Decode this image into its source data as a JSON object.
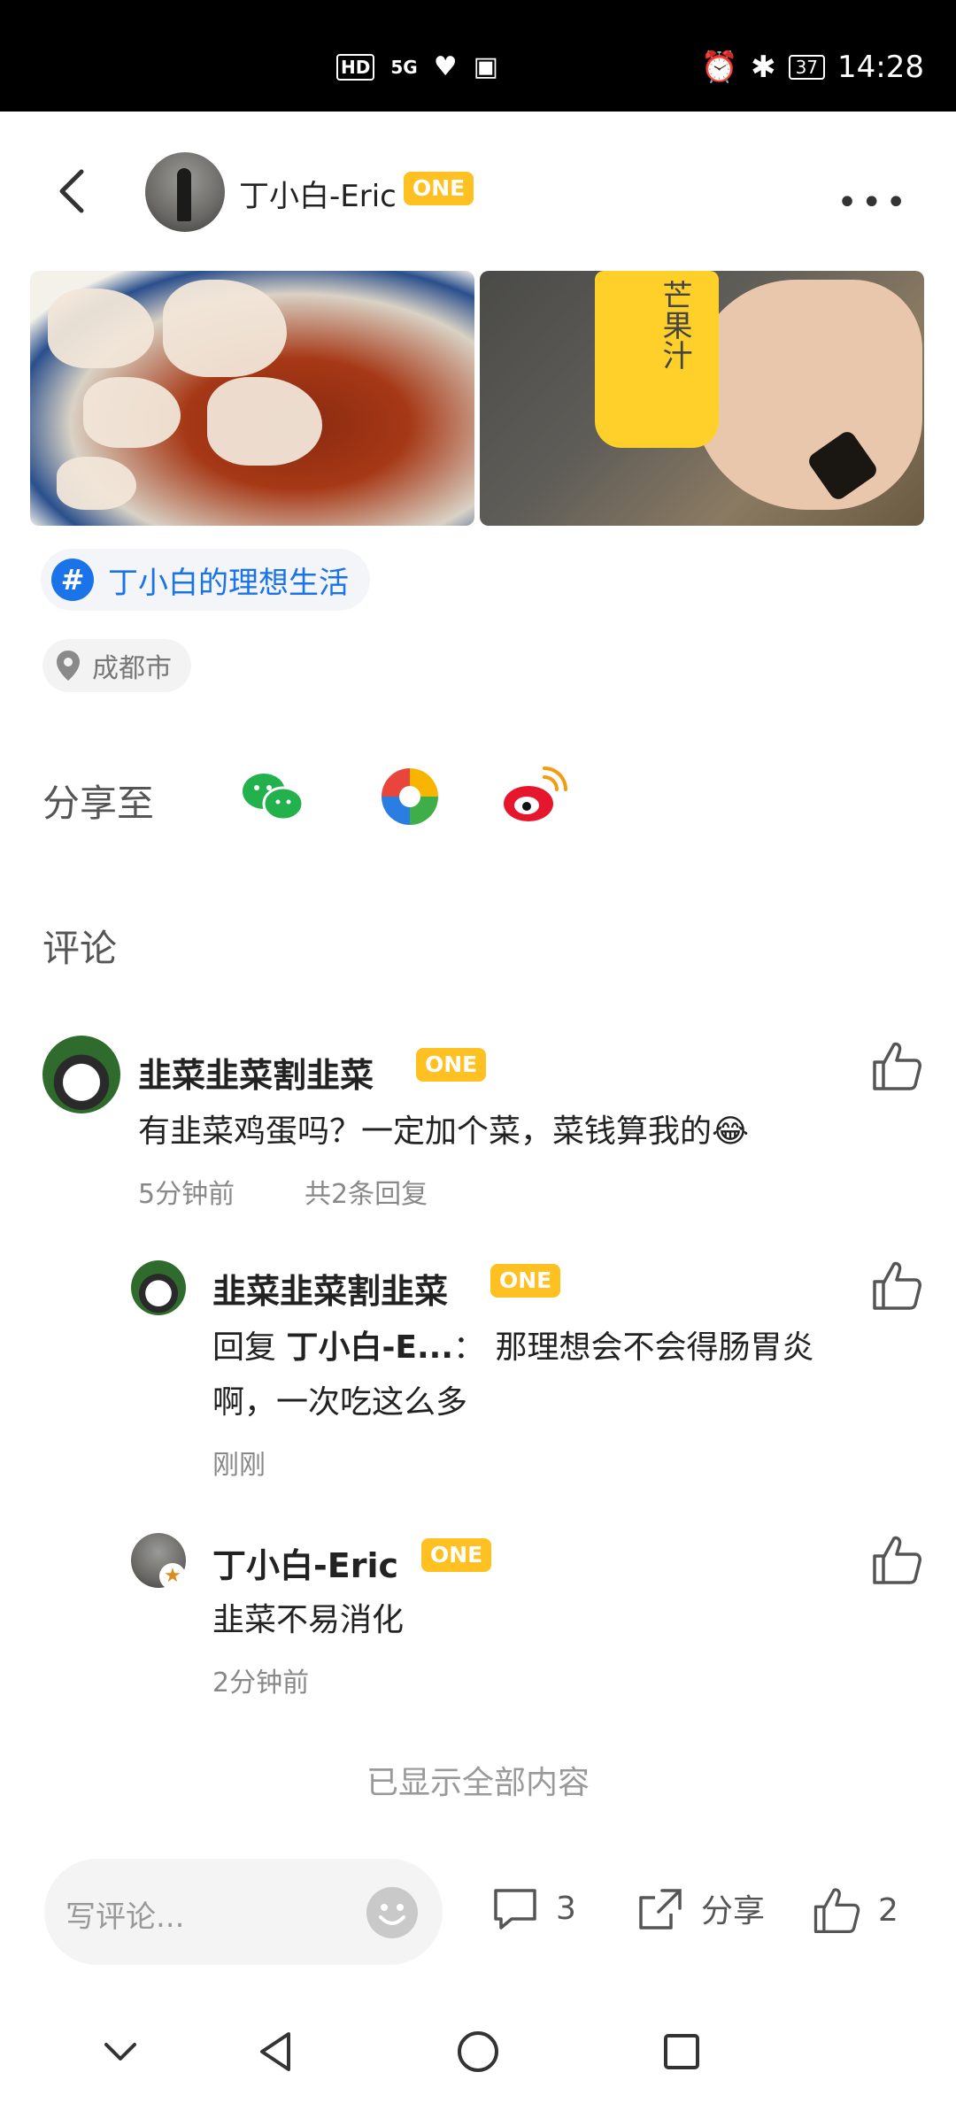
{
  "status_bar": {
    "hd": "HD",
    "signal": "5G",
    "battery": "37",
    "time": "14:28"
  },
  "header": {
    "username": "丁小白-Eric",
    "badge": "ONE"
  },
  "post": {
    "images": [
      "dumplings-photo",
      "juice-bottle-photo"
    ],
    "bottle_text": "芒果汁",
    "topic": "丁小白的理想生活",
    "location": "成都市"
  },
  "share": {
    "label": "分享至",
    "targets": [
      "wechat-icon",
      "moments-icon",
      "weibo-icon"
    ]
  },
  "comments": {
    "title": "评论",
    "items": [
      {
        "author": "韭菜韭菜割韭菜",
        "badge": "ONE",
        "text": "有韭菜鸡蛋吗？一定加个菜，菜钱算我的😂",
        "time": "5分钟前",
        "reply_count": "共2条回复"
      },
      {
        "author": "韭菜韭菜割韭菜",
        "badge": "ONE",
        "reply_prefix": "回复 ",
        "reply_to": "丁小白-E...",
        "reply_colon": "： ",
        "text_line1": "那理想会不会得肠胃炎",
        "text_line2": "啊，一次吃这么多",
        "time": "刚刚"
      },
      {
        "author": "丁小白-Eric",
        "badge": "ONE",
        "text": "韭菜不易消化",
        "time": "2分钟前"
      }
    ],
    "all_loaded": "已显示全部内容"
  },
  "bottom_bar": {
    "comment_placeholder": "写评论...",
    "comment_count": "3",
    "share_label": "分享",
    "like_count": "2"
  },
  "colors": {
    "badge": "#ffc021",
    "link": "#1a73e8",
    "status_bar": "#000000"
  }
}
